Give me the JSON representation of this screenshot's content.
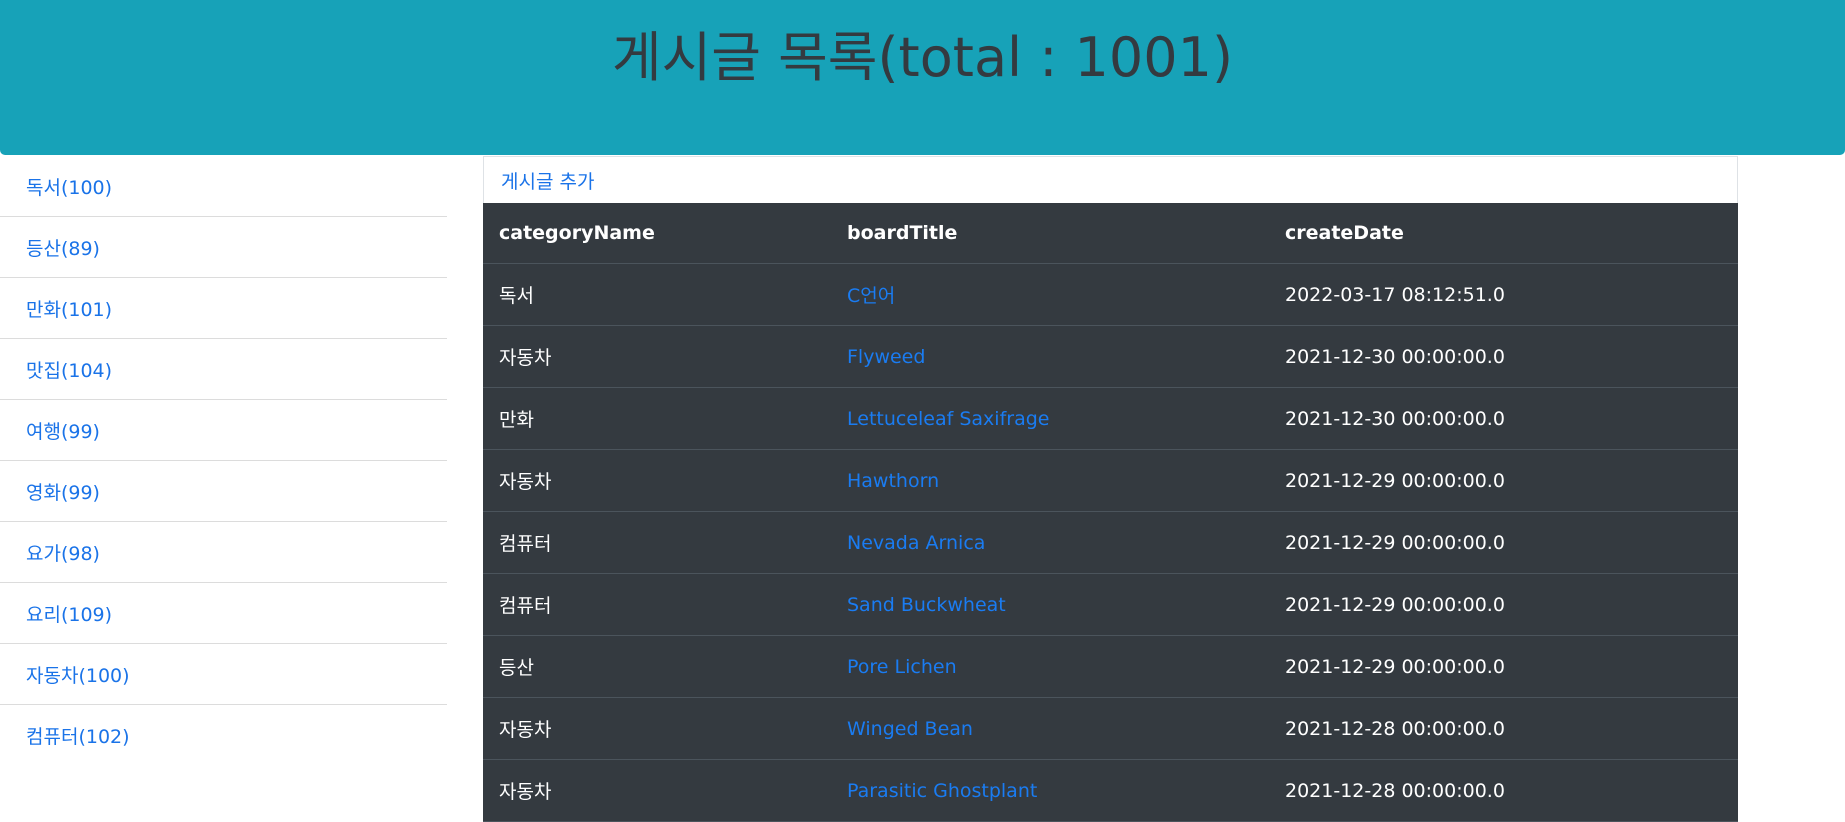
{
  "header": {
    "title": "게시글 목록(total : 1001)"
  },
  "sidebar": {
    "items": [
      {
        "label": "독서(100)"
      },
      {
        "label": "등산(89)"
      },
      {
        "label": "만화(101)"
      },
      {
        "label": "맛집(104)"
      },
      {
        "label": "여행(99)"
      },
      {
        "label": "영화(99)"
      },
      {
        "label": "요가(98)"
      },
      {
        "label": "요리(109)"
      },
      {
        "label": "자동차(100)"
      },
      {
        "label": "컴퓨터(102)"
      }
    ]
  },
  "main": {
    "add_link_label": "게시글 추가",
    "table": {
      "columns": [
        "categoryName",
        "boardTitle",
        "createDate"
      ],
      "rows": [
        {
          "category": "독서",
          "title": "C언어",
          "date": "2022-03-17 08:12:51.0"
        },
        {
          "category": "자동차",
          "title": "Flyweed",
          "date": "2021-12-30 00:00:00.0"
        },
        {
          "category": "만화",
          "title": "Lettuceleaf Saxifrage",
          "date": "2021-12-30 00:00:00.0"
        },
        {
          "category": "자동차",
          "title": "Hawthorn",
          "date": "2021-12-29 00:00:00.0"
        },
        {
          "category": "컴퓨터",
          "title": "Nevada Arnica",
          "date": "2021-12-29 00:00:00.0"
        },
        {
          "category": "컴퓨터",
          "title": "Sand Buckwheat",
          "date": "2021-12-29 00:00:00.0"
        },
        {
          "category": "등산",
          "title": "Pore Lichen",
          "date": "2021-12-29 00:00:00.0"
        },
        {
          "category": "자동차",
          "title": "Winged Bean",
          "date": "2021-12-28 00:00:00.0"
        },
        {
          "category": "자동차",
          "title": "Parasitic Ghostplant",
          "date": "2021-12-28 00:00:00.0"
        }
      ]
    }
  },
  "colors": {
    "header_bg": "#17a2b8",
    "header_text": "#343a40",
    "link": "#1a73e8",
    "table_bg": "#343a40"
  }
}
